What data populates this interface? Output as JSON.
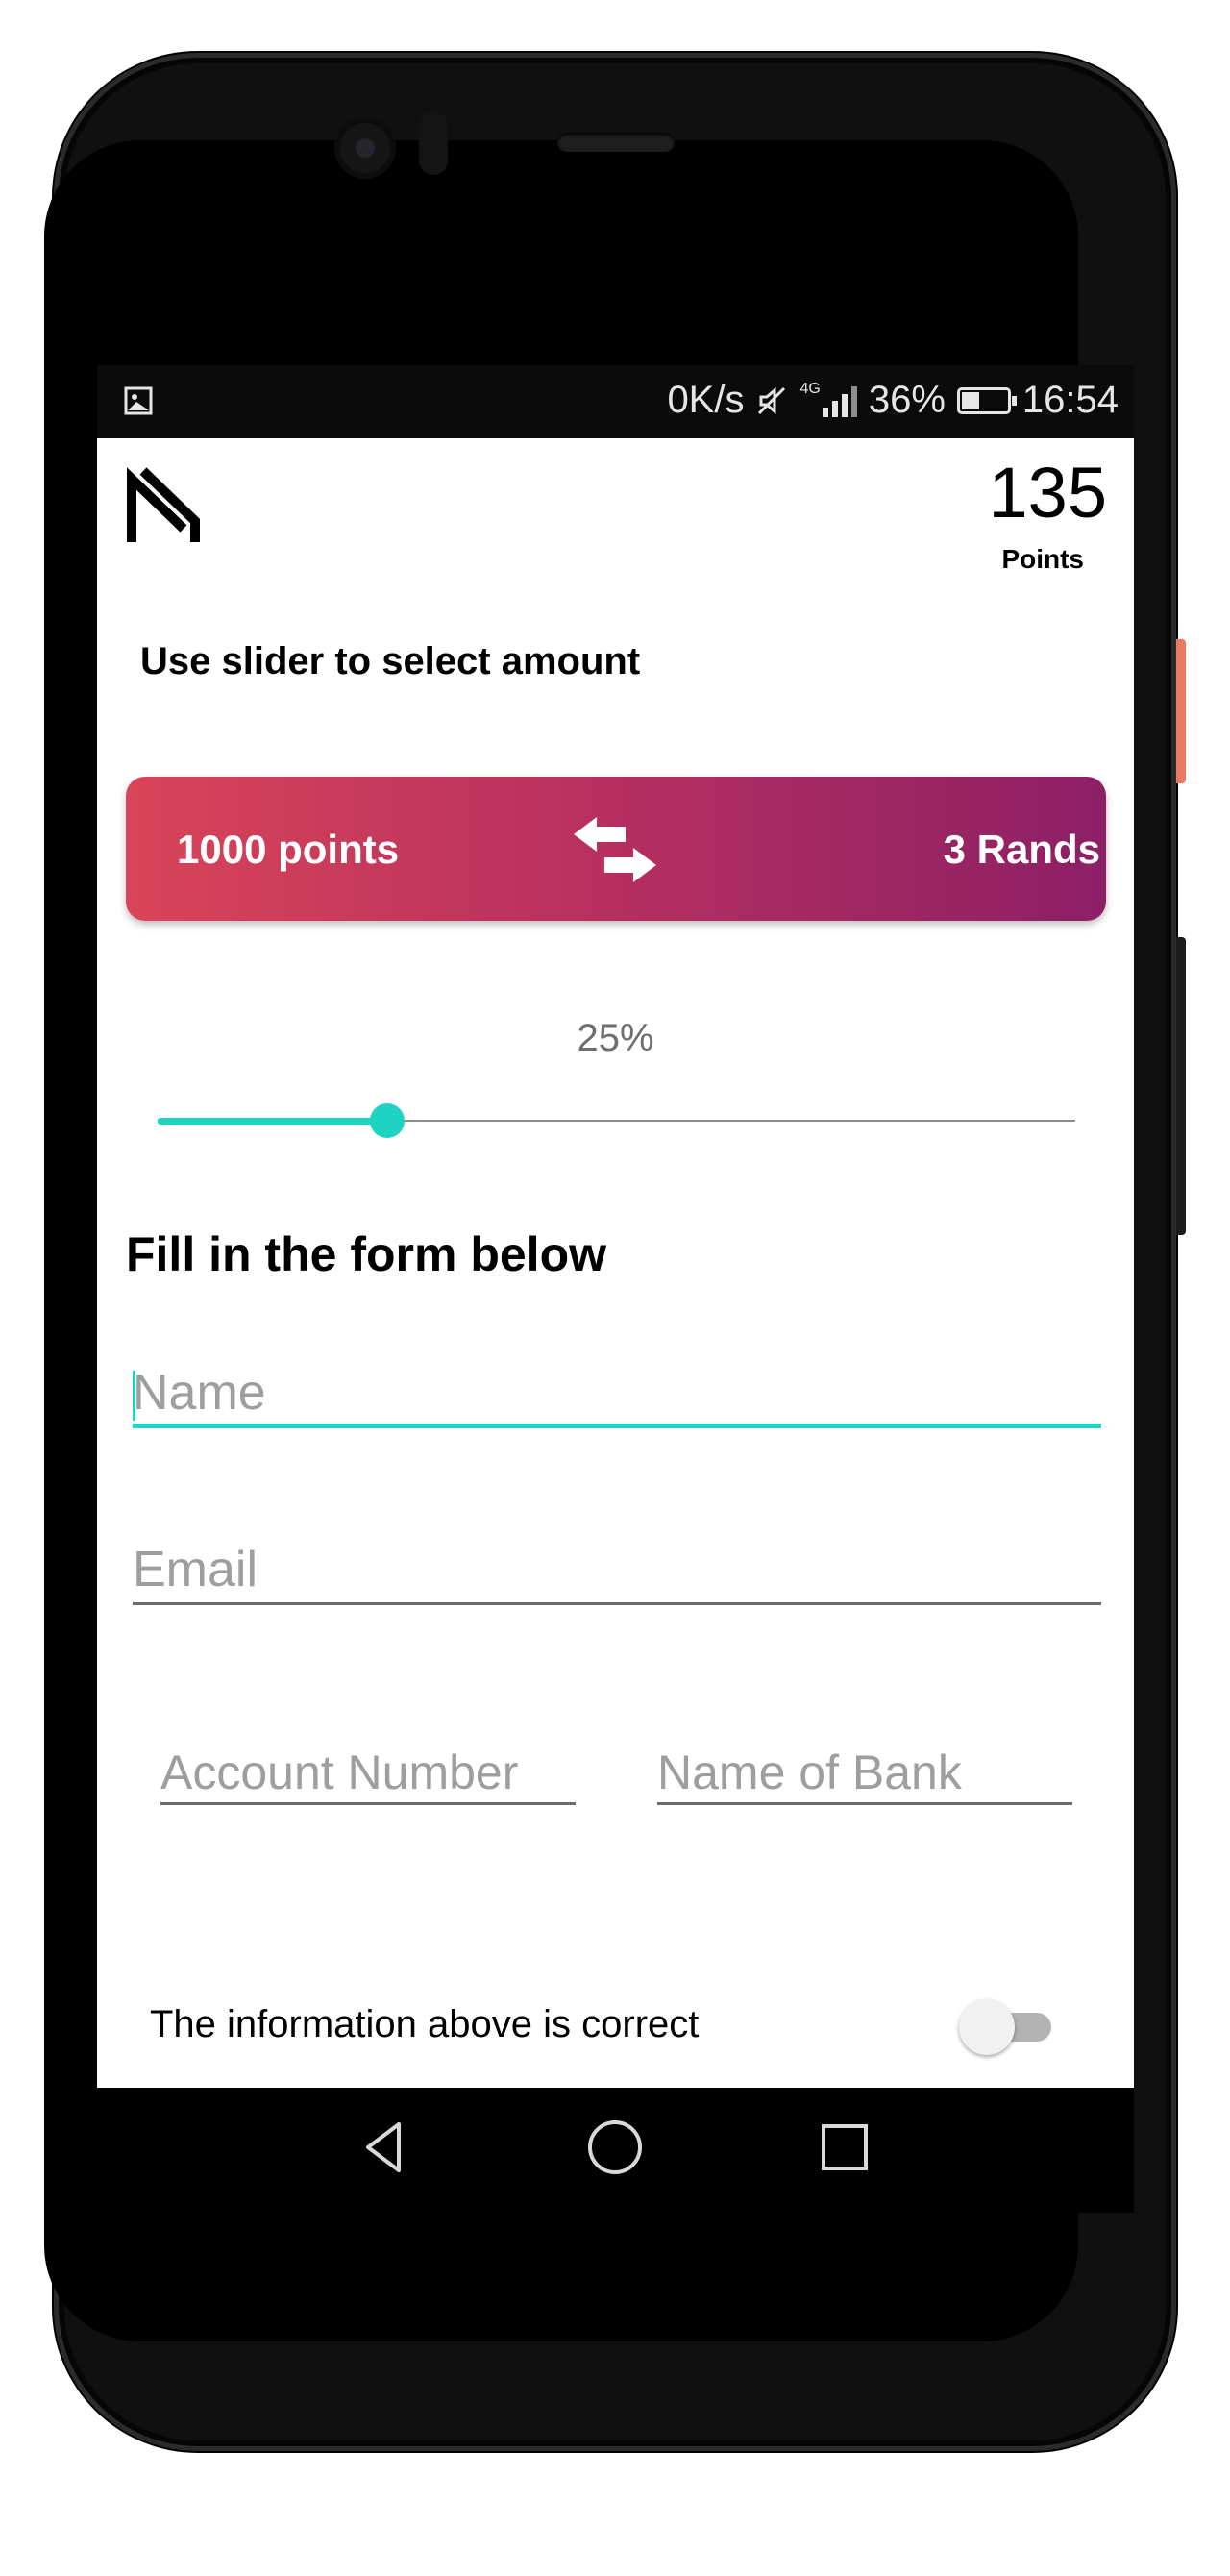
{
  "status_bar": {
    "network_speed": "0K/s",
    "network_type": "4G",
    "battery": "36%",
    "time": "16:54"
  },
  "header": {
    "points_value": "135",
    "points_label": "Points"
  },
  "instruction": "Use slider to select amount",
  "exchange": {
    "from_label": "1000 points",
    "to_label": "3 Rands"
  },
  "slider": {
    "percent_label": "25%",
    "fraction": 0.25
  },
  "form": {
    "title": "Fill in the form below",
    "name_placeholder": "Name",
    "email_placeholder": "Email",
    "account_placeholder": "Account Number",
    "bank_placeholder": "Name of Bank",
    "confirm_label": "The information above is correct",
    "confirm_checked": false
  },
  "icons": {
    "logo": "brand-n-logo",
    "swap": "swap-arrows-icon",
    "nav_back": "back-triangle-icon",
    "nav_home": "home-circle-icon",
    "nav_recents": "recents-square-icon"
  },
  "colors": {
    "accent": "#1ed3c2",
    "gradient_start": "#d94458",
    "gradient_end": "#8c1f66"
  }
}
